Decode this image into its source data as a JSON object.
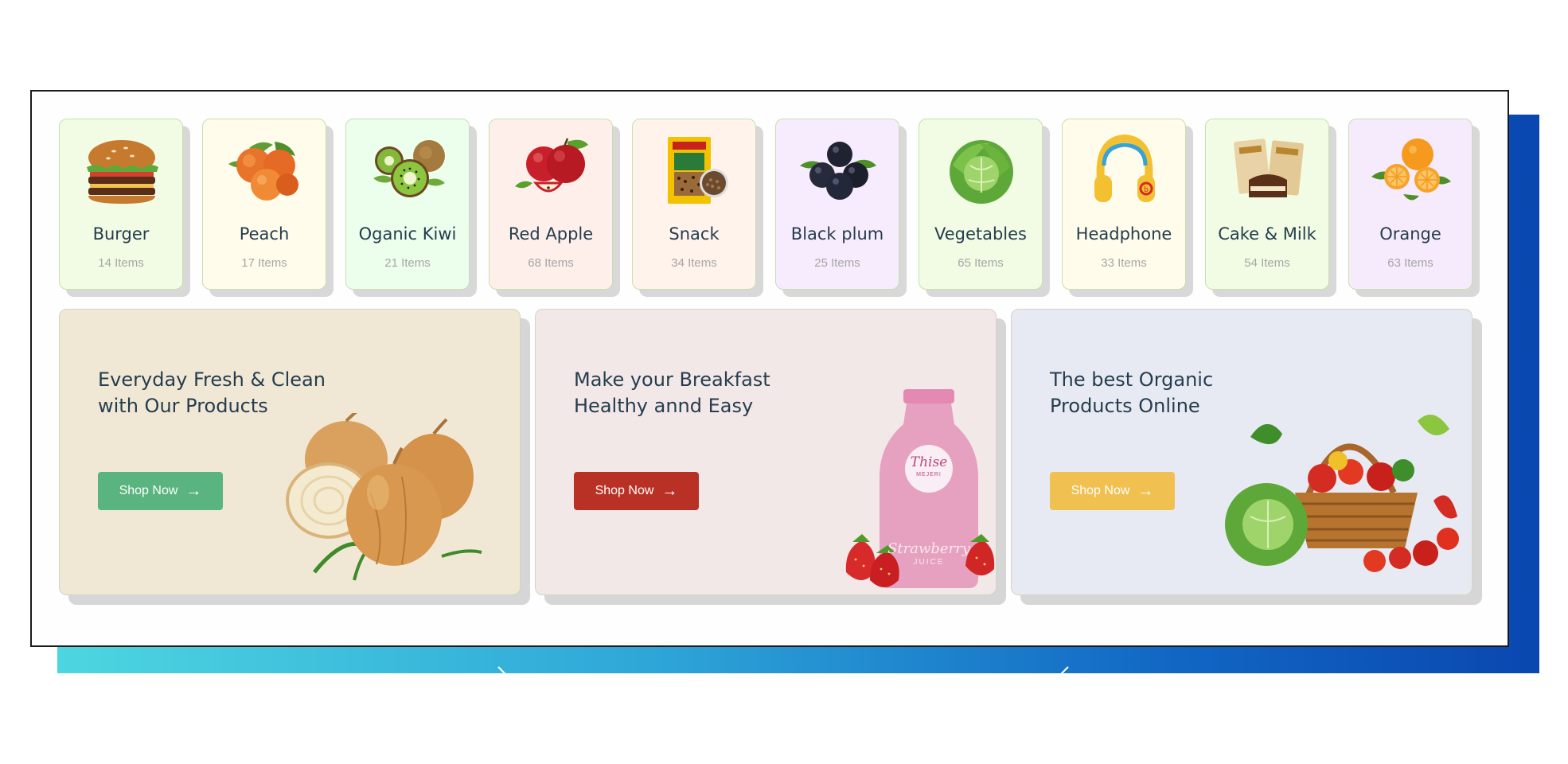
{
  "categories": [
    {
      "name": "Burger",
      "count": "14 Items",
      "icon": "burger-icon",
      "bg": "#f2fce4"
    },
    {
      "name": "Peach",
      "count": "17 Items",
      "icon": "peach-icon",
      "bg": "#fffceb"
    },
    {
      "name": "Oganic Kiwi",
      "count": "21 Items",
      "icon": "kiwi-icon",
      "bg": "#ecffec"
    },
    {
      "name": "Red Apple",
      "count": "68 Items",
      "icon": "apple-icon",
      "bg": "#feefea"
    },
    {
      "name": "Snack",
      "count": "34 Items",
      "icon": "snack-bag-icon",
      "bg": "#fff3eb"
    },
    {
      "name": "Black plum",
      "count": "25 Items",
      "icon": "black-plum-icon",
      "bg": "#f7ecfe"
    },
    {
      "name": "Vegetables",
      "count": "65 Items",
      "icon": "cabbage-icon",
      "bg": "#f2fce4"
    },
    {
      "name": "Headphone",
      "count": "33 Items",
      "icon": "headphone-icon",
      "bg": "#fffceb"
    },
    {
      "name": "Cake & Milk",
      "count": "54 Items",
      "icon": "cake-milk-icon",
      "bg": "#f2fce4"
    },
    {
      "name": "Orange",
      "count": "63 Items",
      "icon": "orange-icon",
      "bg": "#f6ebfc"
    }
  ],
  "banners": [
    {
      "title": "Everyday Fresh & Clean with Our Products",
      "button": "Shop Now",
      "button_color": "#5ab47f",
      "bg": "#f0e8d5",
      "image": "onion-image"
    },
    {
      "title": "Make your Breakfast Healthy annd Easy",
      "button": "Shop Now",
      "button_color": "#b93125",
      "bg": "#f3e8e8",
      "image": "strawberry-juice-image",
      "label_script": "Thise",
      "label_small": "MEJERI",
      "bottle_text": "Strawberry",
      "bottle_sub": "JUICE"
    },
    {
      "title": "The best Organic Products Online",
      "button": "Shop Now",
      "button_color": "#f0c150",
      "bg": "#e7eaf3",
      "image": "vegetable-basket-image"
    }
  ]
}
